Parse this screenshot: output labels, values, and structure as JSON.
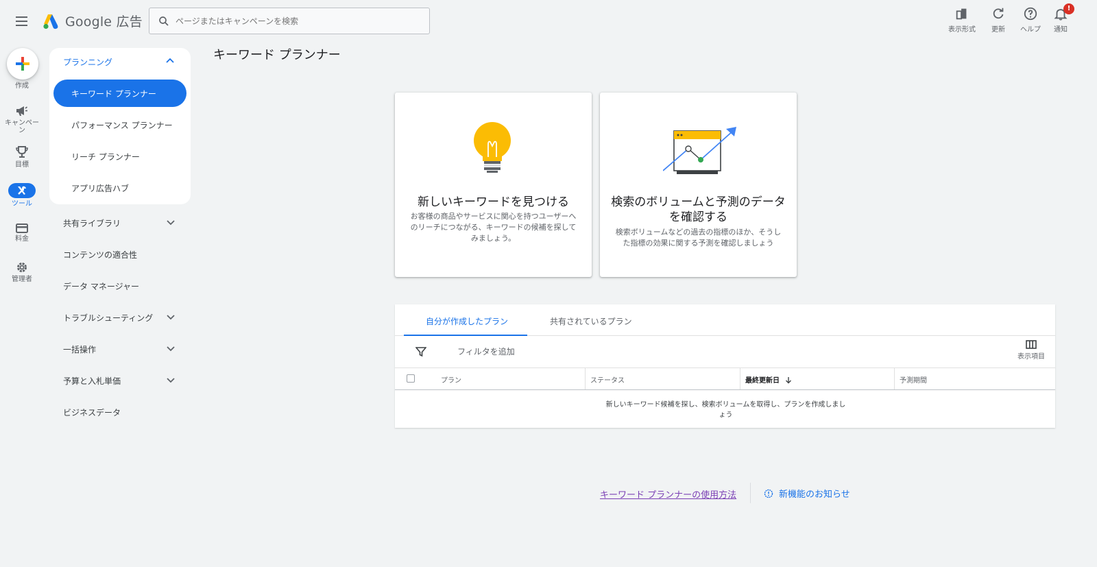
{
  "header": {
    "logo_google": "Google",
    "logo_product": "広告",
    "search_placeholder": "ページまたはキャンペーンを検索",
    "actions": [
      {
        "label": "表示形式",
        "icon": "appearance-icon"
      },
      {
        "label": "更新",
        "icon": "refresh-icon"
      },
      {
        "label": "ヘルプ",
        "icon": "help-icon"
      },
      {
        "label": "通知",
        "icon": "bell-icon"
      }
    ],
    "notification_badge": "!"
  },
  "rail": {
    "items": [
      {
        "label": "作成",
        "icon": "plus-icon"
      },
      {
        "label": "キャンペーン",
        "icon": "megaphone-icon"
      },
      {
        "label": "目標",
        "icon": "trophy-icon"
      },
      {
        "label": "ツール",
        "icon": "tools-icon",
        "active": true
      },
      {
        "label": "料金",
        "icon": "credit-card-icon"
      },
      {
        "label": "管理者",
        "icon": "gear-icon"
      }
    ]
  },
  "nav": {
    "section_title": "プランニング",
    "sub_items": [
      {
        "label": "キーワード プランナー",
        "active": true
      },
      {
        "label": "パフォーマンス プランナー"
      },
      {
        "label": "リーチ プランナー"
      },
      {
        "label": "アプリ広告ハブ"
      }
    ],
    "items": [
      {
        "label": "共有ライブラリ",
        "expandable": true
      },
      {
        "label": "コンテンツの適合性",
        "expandable": false
      },
      {
        "label": "データ マネージャー",
        "expandable": false
      },
      {
        "label": "トラブルシューティング",
        "expandable": true
      },
      {
        "label": "一括操作",
        "expandable": true
      },
      {
        "label": "予算と入札単価",
        "expandable": true
      },
      {
        "label": "ビジネスデータ",
        "expandable": false
      }
    ]
  },
  "main": {
    "title": "キーワード プランナー",
    "cards": [
      {
        "title": "新しいキーワードを見つける",
        "desc": "お客様の商品やサービスに関心を持つユーザーへのリーチにつながる、キーワードの候補を探してみましょう。",
        "icon": "lightbulb-icon"
      },
      {
        "title": "検索のボリュームと予測のデータを確認する",
        "desc": "検索ボリュームなどの過去の指標のほか、そうした指標の効果に関する予測を確認しましょう",
        "icon": "forecast-chart-icon"
      }
    ],
    "plans": {
      "tabs": [
        "自分が作成したプラン",
        "共有されているプラン"
      ],
      "filter_placeholder": "フィルタを追加",
      "columns_button": "表示項目",
      "columns": [
        "プラン",
        "ステータス",
        "最終更新日",
        "予測期間"
      ],
      "sorted_column": "最終更新日",
      "empty_message": "新しいキーワード候補を探し、検索ボリュームを取得し、プランを作成しましょう"
    },
    "footer": {
      "howto_link": "キーワード プランナーの使用方法",
      "news_link": "新機能のお知らせ"
    }
  },
  "colors": {
    "accent": "#1a73e8",
    "background": "#f1f3f4",
    "badge": "#d93025",
    "bulb": "#fbbc04",
    "visited_link": "#7b3fb5"
  }
}
